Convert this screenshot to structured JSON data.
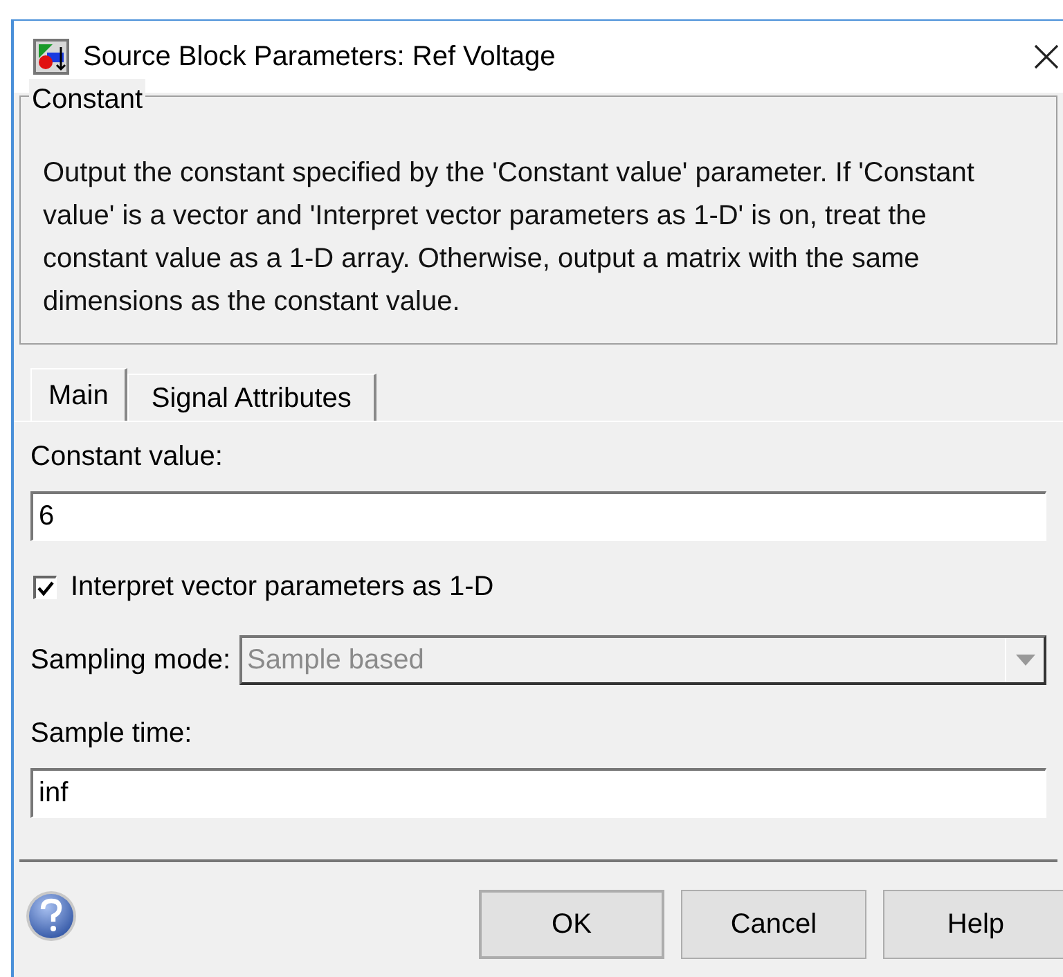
{
  "window": {
    "title": "Source Block Parameters: Ref Voltage"
  },
  "group": {
    "title": "Constant",
    "description": "Output the constant specified by the 'Constant value' parameter. If 'Constant value' is a vector and 'Interpret vector parameters as 1-D' is on, treat the constant value as a 1-D array. Otherwise, output a matrix with the same dimensions as the constant value."
  },
  "tabs": [
    {
      "label": "Main",
      "selected": true
    },
    {
      "label": "Signal Attributes",
      "selected": false
    }
  ],
  "constant_value": {
    "label": "Constant value:",
    "value": "6"
  },
  "interpret_checkbox": {
    "label": "Interpret vector parameters as 1-D",
    "checked": true
  },
  "sampling_mode": {
    "label": "Sampling mode:",
    "value": "Sample based",
    "disabled": true
  },
  "sample_time": {
    "label": "Sample time:",
    "value": "inf"
  },
  "buttons": [
    "OK",
    "Cancel",
    "Help"
  ]
}
